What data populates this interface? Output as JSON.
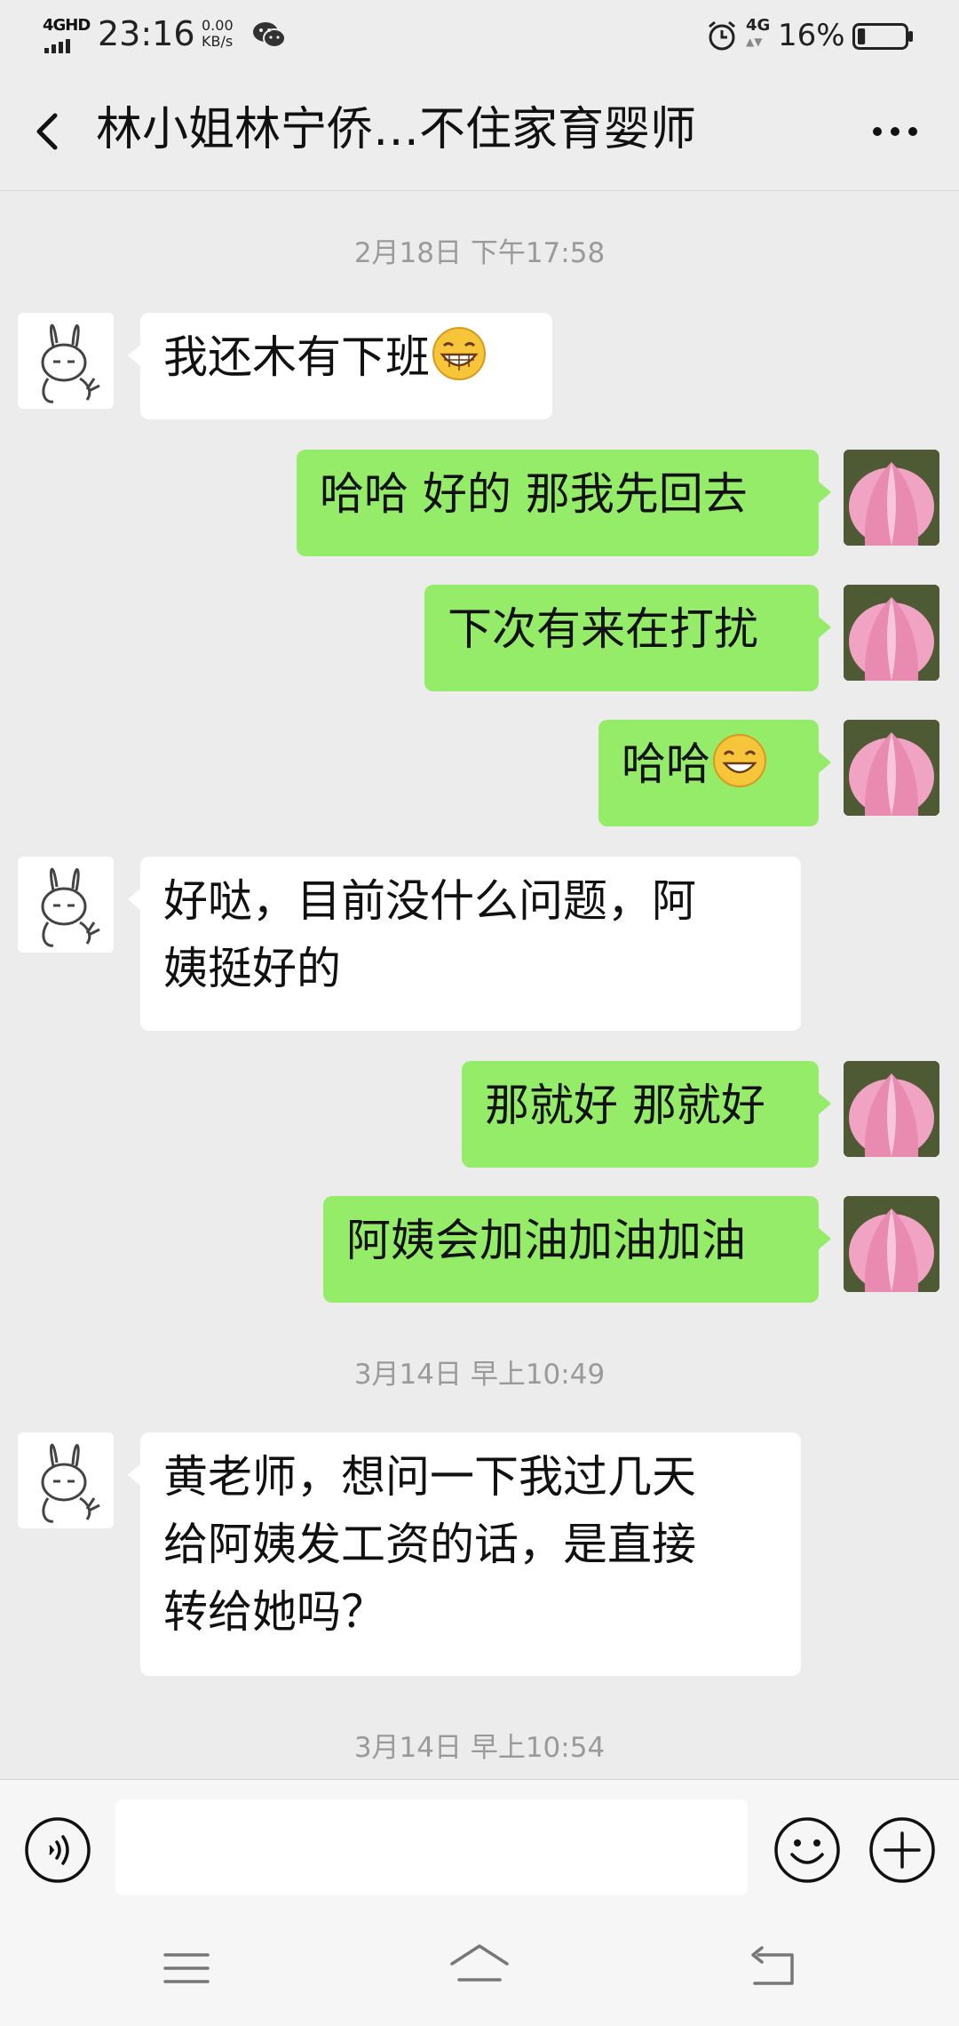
{
  "status_bar": {
    "network_label": "4GHD",
    "time": "23:16",
    "speed_value": "0.00",
    "speed_unit": "KB/s",
    "cellular": "4G",
    "battery_percent": "16%",
    "battery_level": 0.16
  },
  "header": {
    "title": "林小姐林宁侨…不住家育婴师",
    "back_icon": "chevron-left-icon",
    "more_icon": "more-dots-icon"
  },
  "messages": [
    {
      "type": "timestamp",
      "text": "2月18日 下午17:58"
    },
    {
      "type": "message",
      "side": "left",
      "avatar": "rabbit-avatar",
      "text": "我还木有下班",
      "emoji": "grinning-face-icon"
    },
    {
      "type": "message",
      "side": "right",
      "avatar": "lotus-avatar",
      "text": "哈哈 好的 那我先回去"
    },
    {
      "type": "message",
      "side": "right",
      "avatar": "lotus-avatar",
      "text": "下次有来在打扰"
    },
    {
      "type": "message",
      "side": "right",
      "avatar": "lotus-avatar",
      "text": "哈哈",
      "emoji": "smiling-face-icon"
    },
    {
      "type": "message",
      "side": "left",
      "avatar": "rabbit-avatar",
      "lines": [
        "好哒，目前没什么问题，阿",
        "姨挺好的"
      ]
    },
    {
      "type": "message",
      "side": "right",
      "avatar": "lotus-avatar",
      "text": "那就好 那就好"
    },
    {
      "type": "message",
      "side": "right",
      "avatar": "lotus-avatar",
      "text": "阿姨会加油加油加油"
    },
    {
      "type": "timestamp",
      "text": "3月14日 早上10:49"
    },
    {
      "type": "message",
      "side": "left",
      "avatar": "rabbit-avatar",
      "lines": [
        "黄老师，想问一下我过几天",
        "给阿姨发工资的话，是直接",
        "转给她吗？"
      ]
    },
    {
      "type": "timestamp",
      "text": "3月14日 早上10:54"
    }
  ],
  "input_bar": {
    "value": "",
    "voice_icon": "voice-icon",
    "emoji_icon": "emoji-icon",
    "plus_icon": "plus-icon"
  },
  "nav_bar": {
    "menu_icon": "menu-icon",
    "home_icon": "home-icon",
    "back_icon": "back-icon"
  },
  "colors": {
    "background": "#ececec",
    "sent_bubble": "#95ec69",
    "received_bubble": "#ffffff",
    "timestamp_text": "#9a9a9a"
  }
}
